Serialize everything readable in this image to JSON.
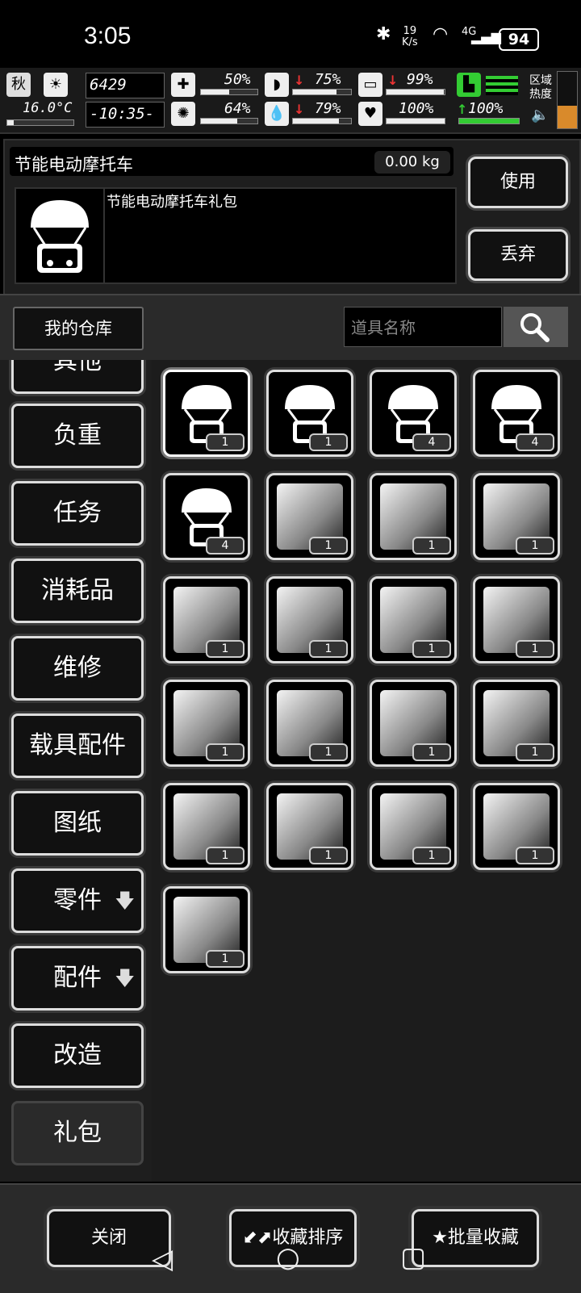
{
  "status_bar": {
    "time": "3:05",
    "net_speed_value": "19",
    "net_speed_unit": "K/s",
    "network": "4G",
    "battery": "94",
    "icons": [
      "bluetooth-icon",
      "wifi-icon",
      "signal-icon"
    ]
  },
  "hud": {
    "season": "秋",
    "temperature": "16.0°C",
    "day": "6429",
    "clock": "-10:35-",
    "health": "50%",
    "stomach": "75%",
    "water_tank": "99%",
    "stamina_bar": "64%",
    "water": "79%",
    "heart": "100%",
    "fitness": "100%",
    "zone_heat_line1": "区域",
    "zone_heat_line2": "热度"
  },
  "item": {
    "name": "节能电动摩托车",
    "weight": "0.00 kg",
    "description": "节能电动摩托车礼包",
    "use_label": "使用",
    "discard_label": "丢弃"
  },
  "search": {
    "warehouse_label": "我的仓库",
    "placeholder": "道具名称"
  },
  "categories": [
    {
      "label": "其他"
    },
    {
      "label": "负重"
    },
    {
      "label": "任务"
    },
    {
      "label": "消耗品"
    },
    {
      "label": "维修"
    },
    {
      "label": "载具配件"
    },
    {
      "label": "图纸"
    },
    {
      "label": "零件",
      "expand": "🡇"
    },
    {
      "label": "配件",
      "expand": "🡇"
    },
    {
      "label": "改造"
    },
    {
      "label": "礼包"
    }
  ],
  "grid": {
    "items": [
      {
        "icon": "parachute-scooter-icon",
        "count": "1"
      },
      {
        "icon": "parachute-tractor-icon",
        "count": "1"
      },
      {
        "icon": "parachute-dragon-bike-icon",
        "count": "4"
      },
      {
        "icon": "parachute-dragon-motorcycle-icon",
        "count": "4"
      },
      {
        "icon": "parachute-dragon-car-icon",
        "count": "4"
      },
      {
        "icon": "motorcycle-icon",
        "count": "1"
      },
      {
        "icon": "motorcycle-icon",
        "count": "1"
      },
      {
        "icon": "motorcycle-icon",
        "count": "1"
      },
      {
        "icon": "motorcycle-icon",
        "count": "1"
      },
      {
        "icon": "car-icon",
        "count": "1"
      },
      {
        "icon": "snake-car-icon",
        "count": "1"
      },
      {
        "icon": "creature-car-icon",
        "count": "1"
      },
      {
        "icon": "golden-wing-icon",
        "count": "1"
      },
      {
        "icon": "balloon-icon",
        "count": "1"
      },
      {
        "icon": "fish-icon",
        "count": "1"
      },
      {
        "icon": "horse-icon",
        "count": "1"
      },
      {
        "icon": "dragon-bike-icon",
        "count": "1"
      },
      {
        "icon": "mech-bike-icon",
        "count": "1"
      },
      {
        "icon": "mech-bike-icon",
        "count": "1"
      },
      {
        "icon": "chopper-bike-icon",
        "count": "1"
      },
      {
        "icon": "sports-car-icon",
        "count": "1"
      }
    ]
  },
  "bottom": {
    "close_label": "关闭",
    "sort_label": "收藏排序",
    "batch_label": "批量收藏"
  }
}
